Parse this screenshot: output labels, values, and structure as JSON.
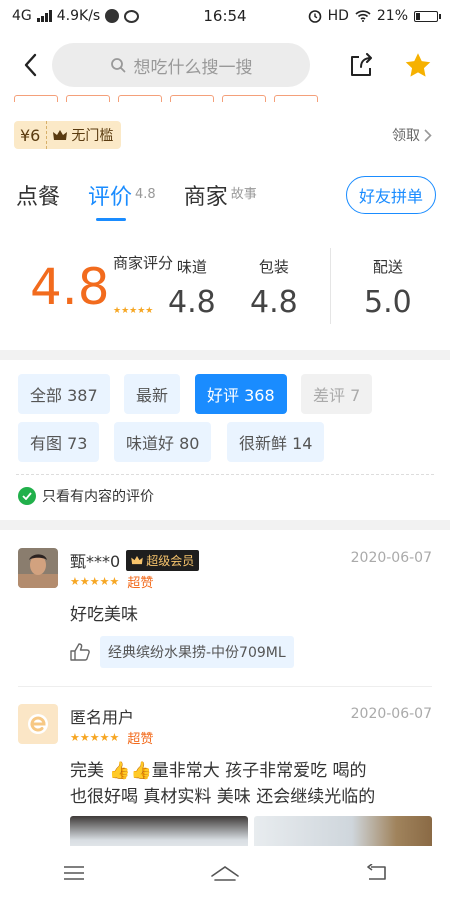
{
  "status": {
    "network": "4G",
    "speed": "4.9K/s",
    "time": "16:54",
    "hd": "HD",
    "battery": "21%",
    "battery_level": 0.21
  },
  "header": {
    "search_placeholder": "想吃什么搜一搜",
    "back_icon": "chevron-left-icon",
    "share_icon": "share-icon",
    "favorite_icon": "star-icon",
    "favorite_color": "#f6b100"
  },
  "coupon": {
    "amount": "¥6",
    "condition": "无门槛",
    "claim_label": "领取"
  },
  "tabs": [
    {
      "label": "点餐",
      "sub": ""
    },
    {
      "label": "评价",
      "sub": "4.8"
    },
    {
      "label": "商家",
      "sub": "故事"
    }
  ],
  "group_button": "好友拼单",
  "scores": {
    "overall": "4.8",
    "overall_label": "商家评分",
    "star_rating": 5,
    "taste_label": "味道",
    "taste": "4.8",
    "packaging_label": "包装",
    "packaging": "4.8",
    "delivery_label": "配送",
    "delivery": "5.0"
  },
  "filters": [
    {
      "label": "全部 387",
      "state": "normal"
    },
    {
      "label": "最新",
      "state": "normal"
    },
    {
      "label": "好评 368",
      "state": "active"
    },
    {
      "label": "差评 7",
      "state": "disabled"
    },
    {
      "label": "有图 73",
      "state": "normal"
    },
    {
      "label": "味道好 80",
      "state": "normal"
    },
    {
      "label": "很新鲜 14",
      "state": "normal"
    }
  ],
  "content_filter": "只看有内容的评价",
  "reviews": [
    {
      "user": "甄***0",
      "badge": "超级会员",
      "date": "2020-06-07",
      "stars": "★★★★★",
      "rating_tag": "超赞",
      "text": "好吃美味",
      "liked_dish": "经典缤纷水果捞-中份709ML"
    },
    {
      "user": "匿名用户",
      "date": "2020-06-07",
      "stars": "★★★★★",
      "rating_tag": "超赞",
      "text_line1": "完美 👍👍量非常大  孩子非常爱吃  喝的",
      "text_line2": "也很好喝  真材实料  美味  还会继续光临的"
    }
  ],
  "colors": {
    "accent": "#1a8cff",
    "score": "#f26b1d",
    "star": "#f6a623"
  }
}
